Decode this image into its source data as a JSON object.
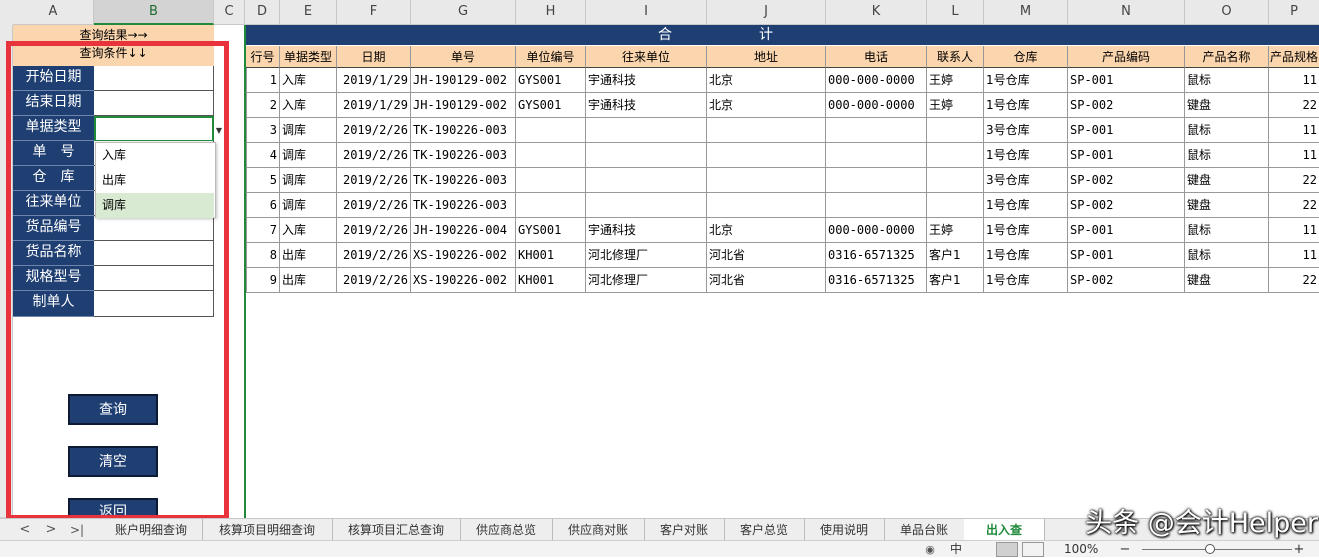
{
  "columns": {
    "letters": [
      "A",
      "B",
      "C",
      "D",
      "E",
      "F",
      "G",
      "H",
      "I",
      "J",
      "K",
      "L",
      "M",
      "N",
      "O",
      "P"
    ]
  },
  "left_panel": {
    "top_label1": "查询结果→→",
    "top_label2": "查询条件↓↓",
    "fields": [
      "开始日期",
      "结束日期",
      "单据类型",
      "单　号",
      "仓　库",
      "往来单位",
      "货品编号",
      "货品名称",
      "规格型号",
      "制单人"
    ],
    "dropdown_options": [
      "入库",
      "出库",
      "调库"
    ],
    "dropdown_selected": "调库",
    "buttons": {
      "query": "查询",
      "clear": "清空",
      "back": "返回"
    }
  },
  "table": {
    "title_left": "合",
    "title_right": "计",
    "headers": [
      "行号",
      "单据类型",
      "日期",
      "单号",
      "单位编号",
      "往来单位",
      "地址",
      "电话",
      "联系人",
      "仓库",
      "产品编码",
      "产品名称",
      "产品规格"
    ],
    "rows": [
      [
        "1",
        "入库",
        "2019/1/29",
        "JH-190129-002",
        "GYS001",
        "宇通科技",
        "北京",
        "000-000-0000",
        "王婷",
        "1号仓库",
        "SP-001",
        "鼠标",
        "11"
      ],
      [
        "2",
        "入库",
        "2019/1/29",
        "JH-190129-002",
        "GYS001",
        "宇通科技",
        "北京",
        "000-000-0000",
        "王婷",
        "1号仓库",
        "SP-002",
        "键盘",
        "22"
      ],
      [
        "3",
        "调库",
        "2019/2/26",
        "TK-190226-003",
        "",
        "",
        "",
        "",
        "",
        "3号仓库",
        "SP-001",
        "鼠标",
        "11"
      ],
      [
        "4",
        "调库",
        "2019/2/26",
        "TK-190226-003",
        "",
        "",
        "",
        "",
        "",
        "1号仓库",
        "SP-001",
        "鼠标",
        "11"
      ],
      [
        "5",
        "调库",
        "2019/2/26",
        "TK-190226-003",
        "",
        "",
        "",
        "",
        "",
        "3号仓库",
        "SP-002",
        "键盘",
        "22"
      ],
      [
        "6",
        "调库",
        "2019/2/26",
        "TK-190226-003",
        "",
        "",
        "",
        "",
        "",
        "1号仓库",
        "SP-002",
        "键盘",
        "22"
      ],
      [
        "7",
        "入库",
        "2019/2/26",
        "JH-190226-004",
        "GYS001",
        "宇通科技",
        "北京",
        "000-000-0000",
        "王婷",
        "1号仓库",
        "SP-001",
        "鼠标",
        "11"
      ],
      [
        "8",
        "出库",
        "2019/2/26",
        "XS-190226-002",
        "KH001",
        "河北修理厂",
        "河北省",
        "0316-6571325",
        "客户1",
        "1号仓库",
        "SP-001",
        "鼠标",
        "11"
      ],
      [
        "9",
        "出库",
        "2019/2/26",
        "XS-190226-002",
        "KH001",
        "河北修理厂",
        "河北省",
        "0316-6571325",
        "客户1",
        "1号仓库",
        "SP-002",
        "键盘",
        "22"
      ]
    ]
  },
  "sheet_tabs": [
    "账户明细查询",
    "核算项目明细查询",
    "核算项目汇总查询",
    "供应商总览",
    "供应商对账",
    "客户对账",
    "客户总览",
    "使用说明",
    "单品台账",
    "出入查"
  ],
  "active_tab": "出入查",
  "nav_arrows": [
    "<",
    ">",
    ">|"
  ],
  "status": {
    "zoom": "100%",
    "minus": "−",
    "plus": "+",
    "mode": "中"
  },
  "watermark": "头条 @会计Helper",
  "colors": {
    "label_blue": "#1f3f73",
    "header_peach": "#fbd5ad",
    "highlight_red": "#e8323c",
    "active_green": "#1e8a3a"
  }
}
